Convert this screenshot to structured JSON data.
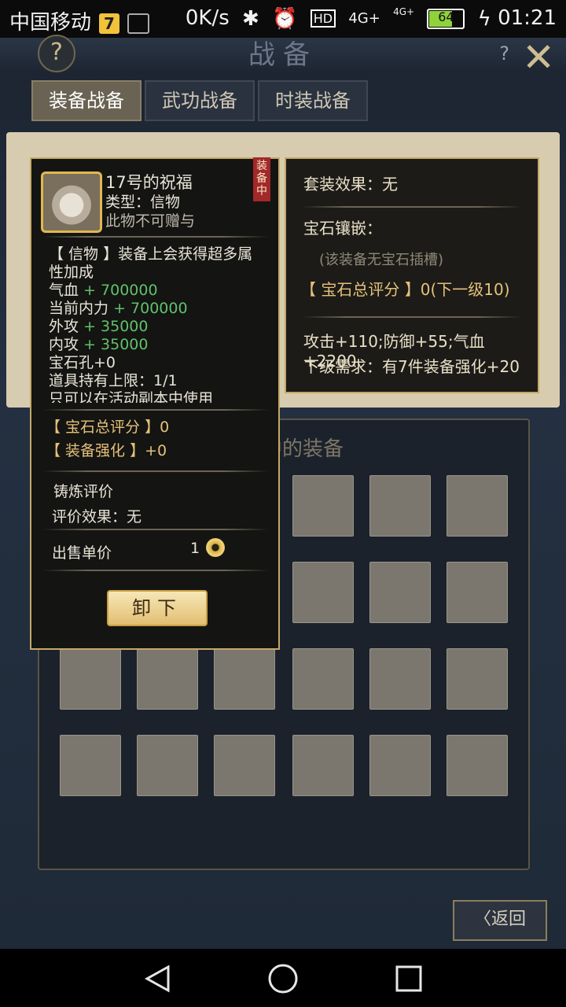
{
  "status_bar": {
    "carrier": "中国移动",
    "carrier_badge": "7",
    "net_speed": "0K/s",
    "network": "4G+",
    "network2": "4G+",
    "hd": "HD",
    "battery": "64",
    "time": "01:21"
  },
  "header": {
    "title": "战备",
    "help_label": "?",
    "help_small_label": "?",
    "close_icon": "close-icon"
  },
  "tabs": [
    {
      "label": "装备战备",
      "active": true
    },
    {
      "label": "武功战备",
      "active": false
    },
    {
      "label": "时装战备",
      "active": false
    }
  ],
  "set_panel": {
    "set_effect": "套装效果：无",
    "gem_inlay": "宝石镶嵌：",
    "no_gem_slot": "(该装备无宝石插槽)",
    "gem_score": "【 宝石总评分 】0(下一级10)",
    "bonus": "攻击+110;防御+55;气血+2200",
    "next_req": "下级需求：有7件装备强化+20"
  },
  "bag": {
    "title": "背包中的装备"
  },
  "item_popup": {
    "name": "17号的祝福",
    "type": "类型：信物",
    "bind": "此物不可赠与",
    "equipped_tag": "装备中",
    "desc": "【 信物 】装备上会获得超多属性加成",
    "stats": [
      {
        "label": "气血",
        "value": "+ 700000"
      },
      {
        "label": "当前内力",
        "value": "+ 700000"
      },
      {
        "label": "外攻",
        "value": "+ 35000"
      },
      {
        "label": "内攻",
        "value": "+ 35000"
      }
    ],
    "gem_holes": "宝石孔+0",
    "hold_limit": "道具持有上限：1/1",
    "usage_note": "只可以在活动副本中使用",
    "gem_total": "【 宝石总评分 】0",
    "enhance": "【 装备强化 】+0",
    "forge_title": "铸炼评价",
    "forge_effect": "评价效果：无",
    "sell_label": "出售单价",
    "sell_price": "1",
    "unequip_button": "卸下"
  },
  "back_button": "返回",
  "colors": {
    "accent_gold": "#c5a865",
    "stat_green": "#5fc26b",
    "tag_red": "#a2282a"
  }
}
